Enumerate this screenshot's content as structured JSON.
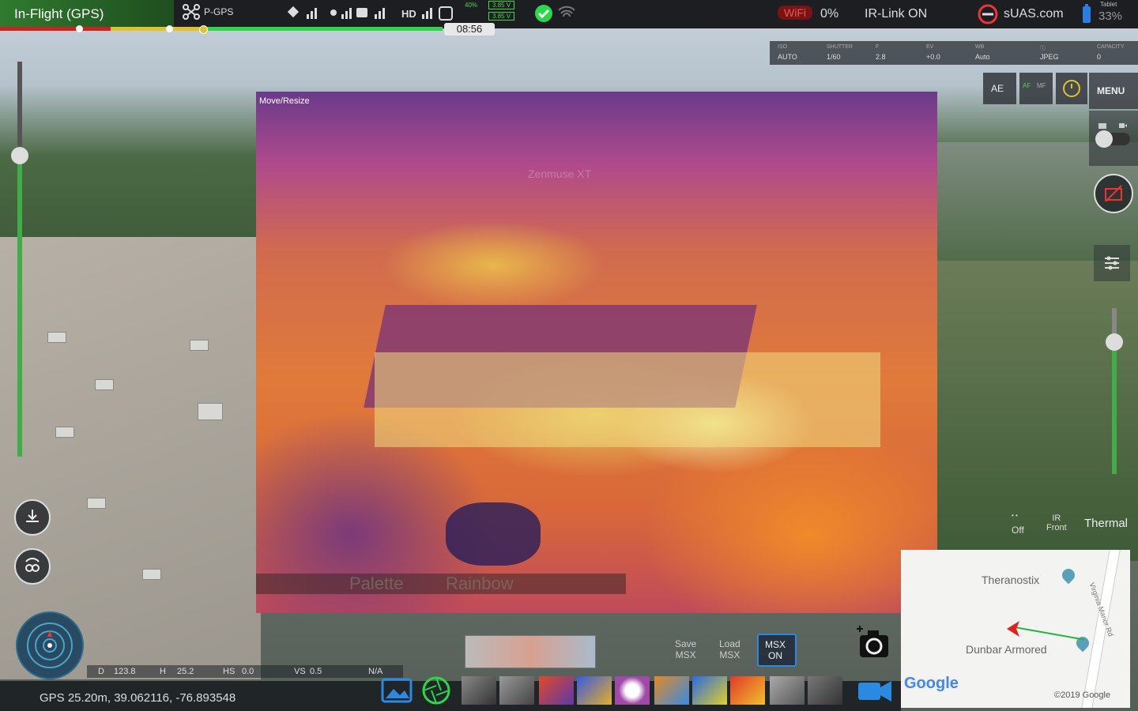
{
  "status": {
    "flight_mode": "In-Flight (GPS)",
    "gps_mode": "P-GPS",
    "hd_label": "HD",
    "battery_small_pct": "40%",
    "volt_readout_1": "3.85 V",
    "volt_readout_2": "3.85 V",
    "wifi_label": "WiFi",
    "wifi_pct": "0%",
    "ir_link": "IR-Link ON",
    "brand": "sUAS.com",
    "tablet_label": "Tablet",
    "tablet_pct": "33%",
    "flight_time": "08:56"
  },
  "camera_settings": {
    "items": [
      {
        "label": "ISO",
        "value": "AUTO"
      },
      {
        "label": "SHUTTER",
        "value": "1/60"
      },
      {
        "label": "F",
        "value": "2.8"
      },
      {
        "label": "EV",
        "value": "+0.0"
      },
      {
        "label": "WB",
        "value": "Auto"
      },
      {
        "label": "ⓘ",
        "value": "JPEG"
      },
      {
        "label": "CAPACITY",
        "value": "0"
      }
    ]
  },
  "right_panel": {
    "ae_label": "AE",
    "af_label": "AF",
    "mf_label": "MF",
    "menu_label": "MENU",
    "mode_off": "Off",
    "mode_ir_front": "IR\nFront",
    "mode_thermal": "Thermal"
  },
  "thermal_view": {
    "move_resize": "Move/Resize",
    "sensor_label": "Zenmuse XT",
    "palette_label": "Palette",
    "palette_value": "Rainbow"
  },
  "telemetry": {
    "d_label": "D",
    "d_value": "123.8",
    "h_label": "H",
    "h_value": "25.2",
    "hs_label": "HS",
    "hs_value": "0.0",
    "vs_label": "VS",
    "vs_value": "0.5",
    "gps_line": "GPS 25.20m, 39.062116, -76.893548",
    "na_label": "N/A"
  },
  "msx": {
    "save_msx": "Save\nMSX",
    "load_msx": "Load\nMSX",
    "msx_on": "MSX\nON"
  },
  "map": {
    "place_1": "Theranostix",
    "place_2": "Dunbar Armored",
    "road": "Virginia Manor Rd",
    "google": "Google",
    "copyright": "©2019 Google"
  },
  "colors": {
    "accent_green": "#3fae49",
    "warning_red": "#d21f1f",
    "status_yellow": "#e1c22a",
    "ok_green": "#2bd84a"
  },
  "icons": [
    "drone-icon",
    "satellite-icon",
    "rc-signal-icon",
    "hd-signal-icon",
    "battery-icon",
    "check-icon",
    "wifi-icon",
    "link-icon",
    "tablet-battery-icon",
    "download-icon",
    "return-home-icon",
    "compass-icon",
    "gallery-icon",
    "aperture-icon",
    "camera-icon",
    "video-icon",
    "no-photo-icon",
    "settings-sliders-icon",
    "map-pin-icon"
  ]
}
